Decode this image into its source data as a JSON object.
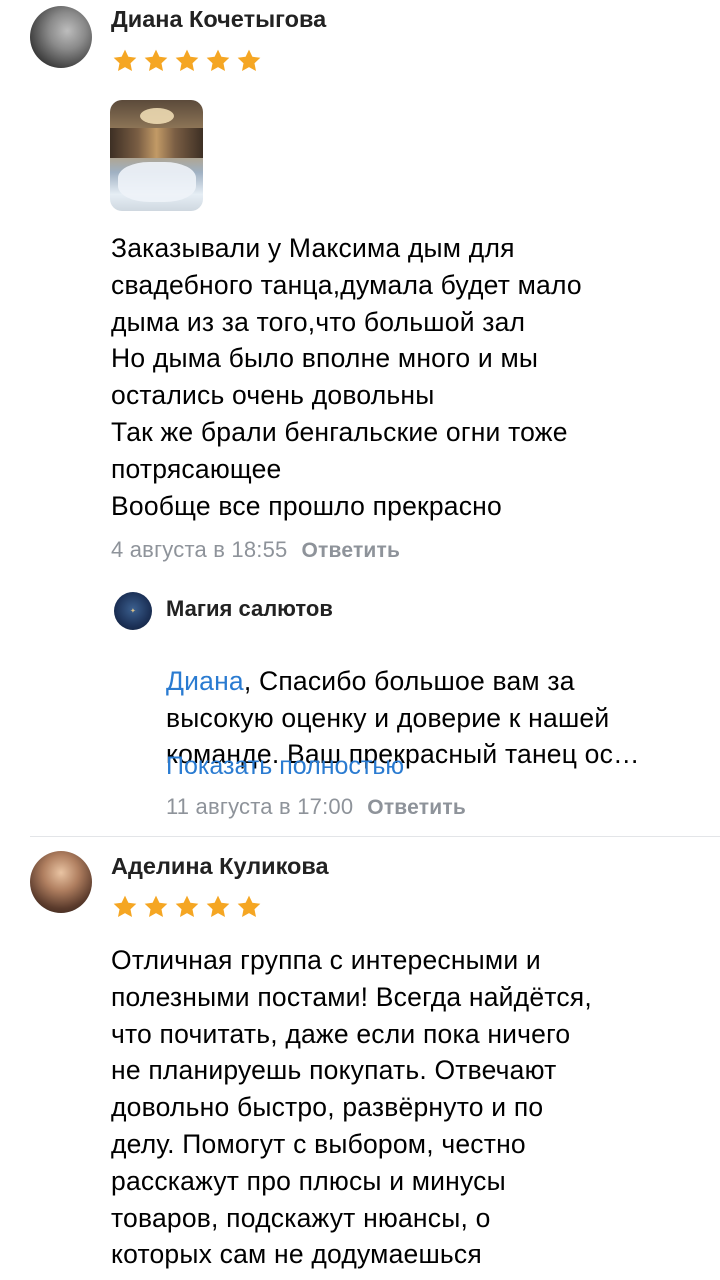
{
  "review1": {
    "author": "Диана Кочетыгова",
    "rating": 5,
    "text": "Заказывали у Максима дым для\nсвадебного танца,думала будет мало\nдыма из за того,что большой зал\nНо дыма было вполне много и мы\nостались очень довольны\nТак же брали бенгальские огни тоже\nпотрясающее\nВообще все прошло прекрасно",
    "date": "4 августа в 18:55",
    "reply_label": "Ответить",
    "reply": {
      "author": "Магия салютов",
      "mention": "Диана",
      "text_first": ", Спасибо большое вам за",
      "text_rest": "высокую оценку и доверие к нашей\nкоманде. Ваш прекрасный танец ос…",
      "show_more": "Показать полностью",
      "date": "11 августа в 17:00",
      "reply_label": "Ответить"
    }
  },
  "review2": {
    "author": "Аделина Куликова",
    "rating": 5,
    "text": "Отличная группа с интересными и\nполезными постами! Всегда найдётся,\nчто почитать, даже если пока ничего\nне планируешь покупать. Отвечают\nдовольно быстро, развёрнуто и по\nделу. Помогут с выбором, честно\nрасскажут про плюсы и минусы\nтоваров, подскажут нюансы, о\nкоторых сам не додумаешься"
  },
  "colors": {
    "star": "#f5a623",
    "link": "#2a7bd1",
    "meta": "#8e939a"
  }
}
